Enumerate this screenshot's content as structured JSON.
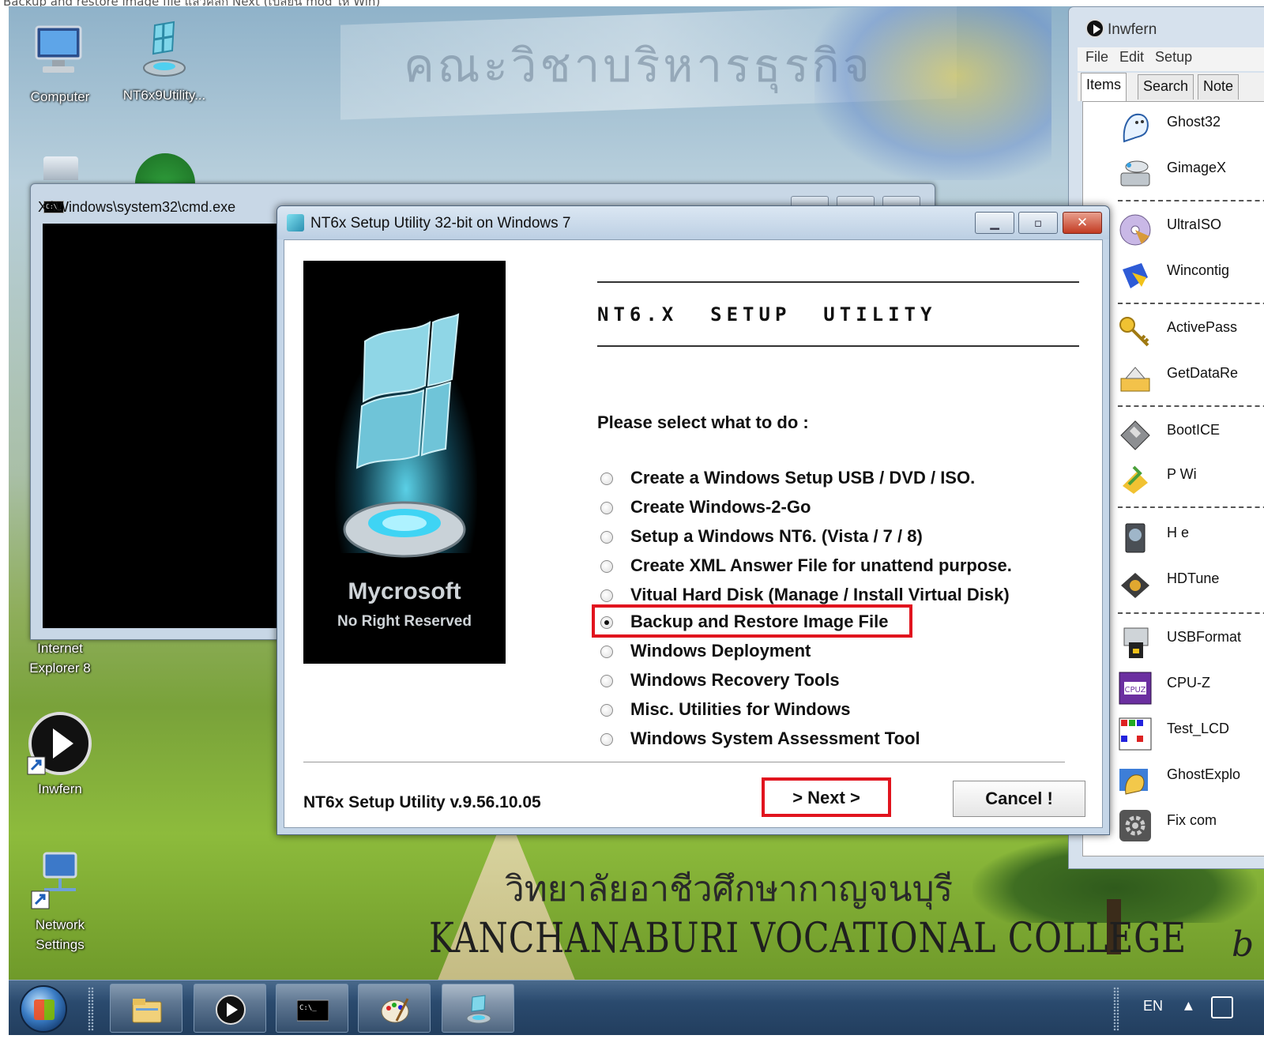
{
  "caption": "Backup and restore image file แล้วคลิก Next (เปลี่ยน mod ให้ Win)",
  "desktop": {
    "banner_text": "คณะวิชาบริหารธุรกิจ",
    "thai_title": "วิทยาลัยอาชีวศึกษากาญจนบุรี",
    "college_title": "KANCHANABURI VOCATIONAL COLLEGE",
    "icons": [
      {
        "label": "Computer",
        "icon": "computer-icon"
      },
      {
        "label": "NT6x9Utility...",
        "icon": "nt6-utility-icon"
      },
      {
        "label": "Internet Explorer 8",
        "icon": "internet-explorer-icon"
      },
      {
        "label": "Inwfern",
        "icon": "inwfern-play-icon"
      },
      {
        "label": "Network Settings",
        "icon": "network-settings-icon"
      }
    ]
  },
  "cmd_window": {
    "title": "X:\\Windows\\system32\\cmd.exe",
    "icon_text": "C:\\_"
  },
  "inwfern": {
    "title": "Inwfern",
    "menu": [
      "File",
      "Edit",
      "Setup"
    ],
    "tabs": [
      "Items",
      "Search",
      "Note"
    ],
    "items": [
      "Ghost32",
      "GimageX",
      "UltraISO",
      "Wincontig",
      "ActivePass",
      "GetDataRe",
      "BootICE",
      "P          Wi",
      "H          e",
      "HDTune",
      "USBFormat",
      "CPU-Z",
      "Test_LCD",
      "GhostExplo",
      "Fix com"
    ]
  },
  "dialog": {
    "title": "NT6x Setup Utility 32-bit on Windows 7",
    "logo_text": "Mycrosoft",
    "logo_sub": "No Right Reserved",
    "heading": "NT6.X  SETUP  UTILITY",
    "prompt": "Please select what to do :",
    "options": [
      "Create a Windows Setup USB / DVD / ISO.",
      "Create Windows-2-Go",
      "Setup a Windows NT6. (Vista / 7 / 8)",
      "Create XML Answer File for unattend purpose.",
      "Vitual Hard Disk (Manage / Install Virtual Disk)",
      "Backup and Restore Image File",
      "Windows Deployment",
      "Windows Recovery Tools",
      "Misc. Utilities for Windows",
      "Windows System Assessment Tool"
    ],
    "selected_option": "Backup and Restore Image File",
    "version": "NT6x Setup Utility v.9.56.10.05",
    "next_label": "> Next >",
    "cancel_label": "Cancel !",
    "highlight_color": "#e1141e"
  },
  "taskbar": {
    "buttons": [
      "explorer-folder-icon",
      "inwfern-play-icon",
      "cmd-icon",
      "paint-icon",
      "nt6-utility-icon"
    ],
    "tray_lang": "EN",
    "tray_arrow": "▲"
  }
}
